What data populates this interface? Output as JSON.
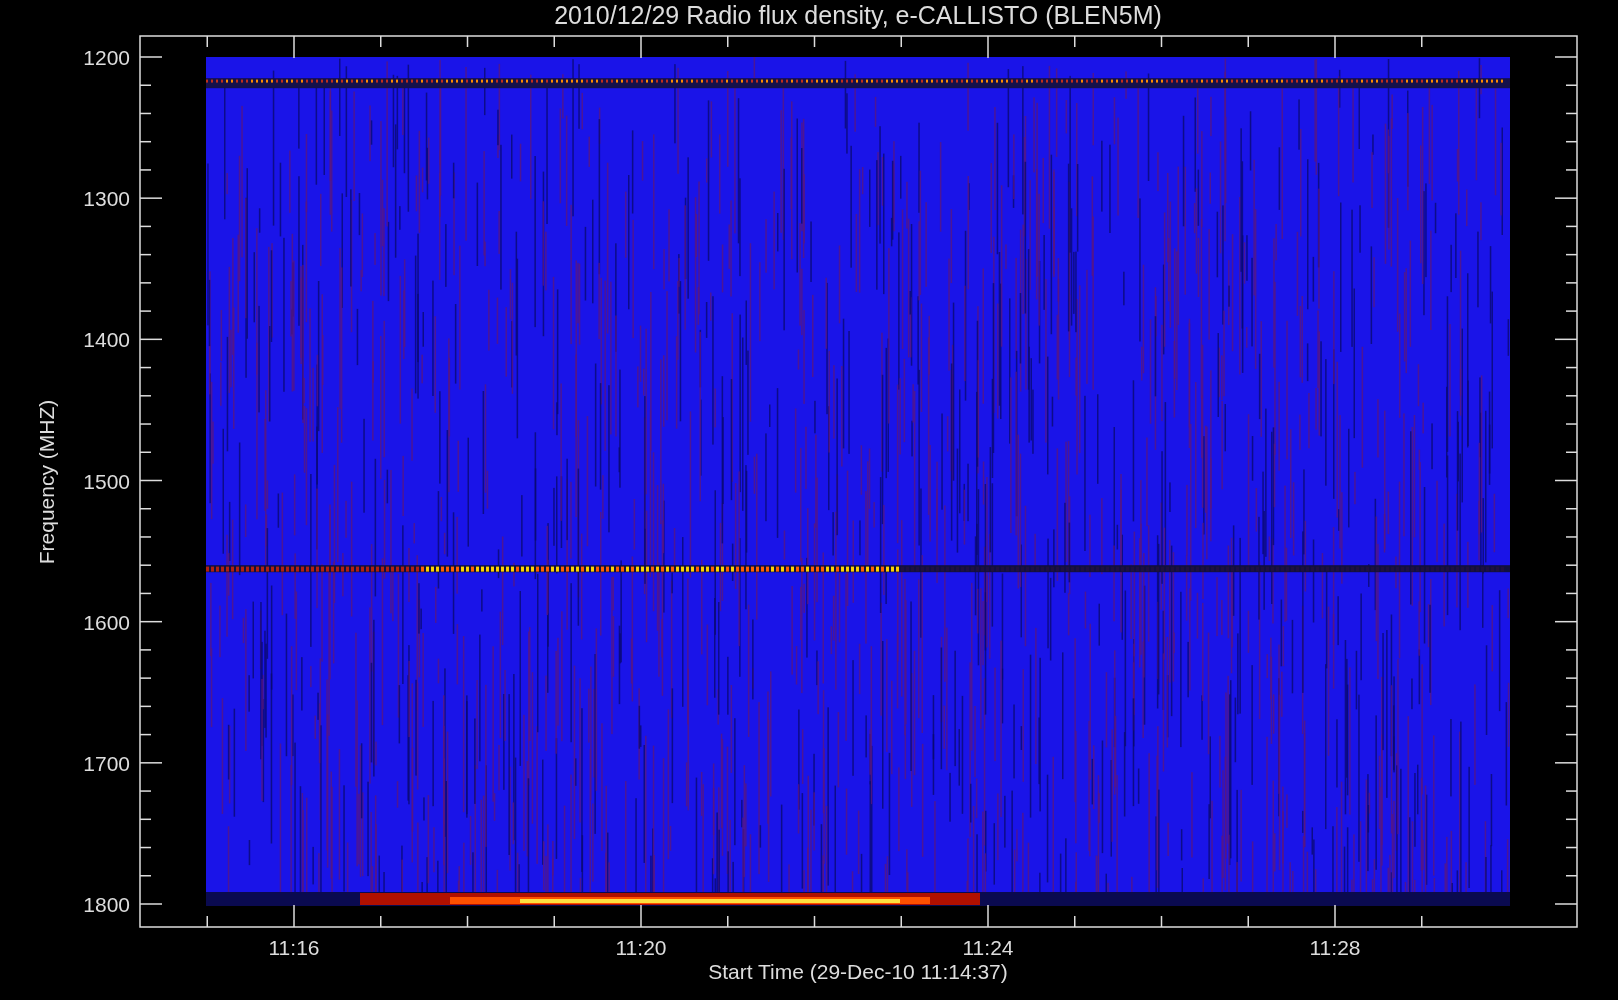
{
  "title": "2010/12/29  Radio flux density, e-CALLISTO (BLEN5M)",
  "y_axis": {
    "label": "Frequency (MHZ)",
    "ticks": [
      "1200",
      "1300",
      "1400",
      "1500",
      "1600",
      "1700",
      "1800"
    ]
  },
  "x_axis": {
    "label": "Start Time (29-Dec-10 11:14:37)",
    "ticks": [
      "11:16",
      "11:20",
      "11:24",
      "11:28"
    ]
  }
}
